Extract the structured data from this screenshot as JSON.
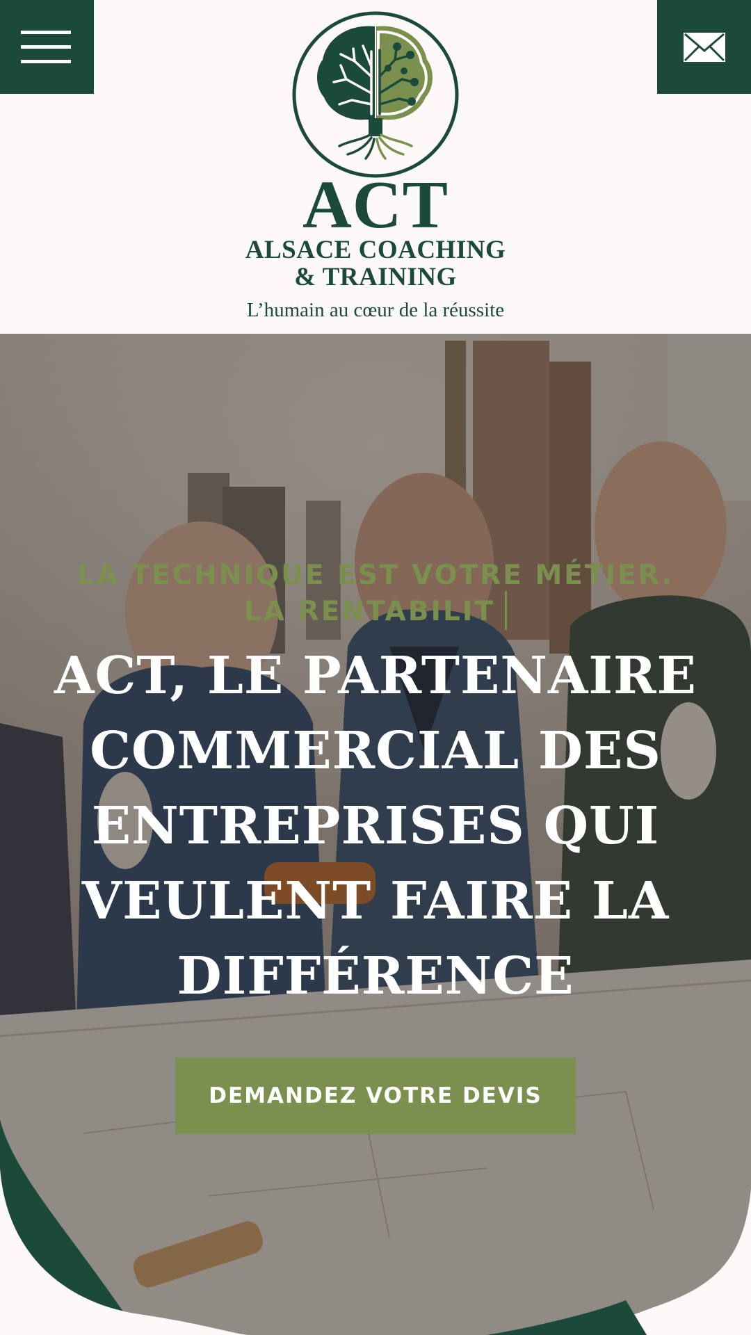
{
  "header": {
    "menu_icon": "hamburger-menu-icon",
    "mail_icon": "envelope-icon",
    "logo": {
      "title": "ACT",
      "subtitle_line1": "ALSACE COACHING",
      "subtitle_line2": "& TRAINING",
      "tagline": "L’humain au cœur de la réussite"
    }
  },
  "hero": {
    "kicker": "LA TECHNIQUE EST VOTRE MÉTIER. LA RENTABILIT",
    "title": "ACT, LE PARTENAIRE COMMERCIAL DES ENTREPRISES QUI VEULENT FAIRE LA DIFFÉRENCE",
    "cta_label": "DEMANDEZ VOTRE DEVIS"
  },
  "colors": {
    "brand_dark_green": "#1c4a3a",
    "brand_olive": "#7b8f4e",
    "background": "#fcf9f8"
  }
}
